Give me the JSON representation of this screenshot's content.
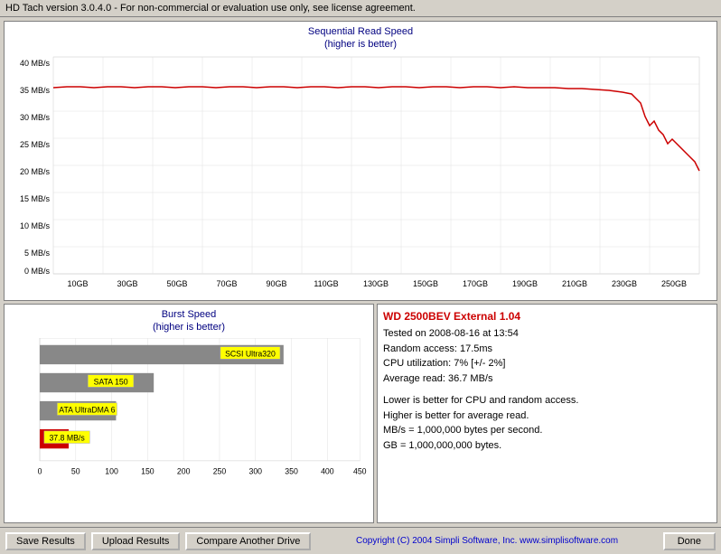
{
  "titleBar": {
    "text": "HD Tach version 3.0.4.0  -  For non-commercial or evaluation use only, see license agreement."
  },
  "sequentialChart": {
    "title1": "Sequential Read Speed",
    "title2": "(higher is better)",
    "yLabels": [
      "40 MB/s",
      "35 MB/s",
      "30 MB/s",
      "25 MB/s",
      "20 MB/s",
      "15 MB/s",
      "10 MB/s",
      "5 MB/s",
      "0 MB/s"
    ],
    "xLabels": [
      "10GB",
      "30GB",
      "50GB",
      "70GB",
      "90GB",
      "110GB",
      "130GB",
      "150GB",
      "170GB",
      "190GB",
      "210GB",
      "230GB",
      "250GB"
    ]
  },
  "burstChart": {
    "title1": "Burst Speed",
    "title2": "(higher is better)",
    "xLabels": [
      "0",
      "50",
      "100",
      "150",
      "200",
      "250",
      "300",
      "350",
      "400",
      "450"
    ],
    "bars": [
      {
        "label": "SCSI Ultra320",
        "value": 320,
        "color": "#888",
        "maxDisplay": 420
      },
      {
        "label": "SATA 150",
        "value": 150,
        "color": "#888",
        "maxDisplay": 420
      },
      {
        "label": "ATA UltraDMA 6",
        "value": 100,
        "color": "#888",
        "maxDisplay": 420
      },
      {
        "label": "37.8 MB/s",
        "value": 37.8,
        "color": "#cc0000",
        "maxDisplay": 420
      }
    ]
  },
  "infoPanel": {
    "driveName": "WD 2500BEV External 1.04",
    "line1": "Tested on 2008-08-16 at 13:54",
    "line2": "Random access: 17.5ms",
    "line3": "CPU utilization: 7% [+/- 2%]",
    "line4": "Average read: 36.7 MB/s",
    "note1": "Lower is better for CPU and random access.",
    "note2": "Higher is better for average read.",
    "note3": "MB/s = 1,000,000 bytes per second.",
    "note4": "GB = 1,000,000,000 bytes."
  },
  "footer": {
    "saveBtn": "Save Results",
    "uploadBtn": "Upload Results",
    "compareBtn": "Compare Another Drive",
    "copyright": "Copyright (C) 2004 Simpli Software, Inc. www.simplisoftware.com",
    "doneBtn": "Done"
  }
}
